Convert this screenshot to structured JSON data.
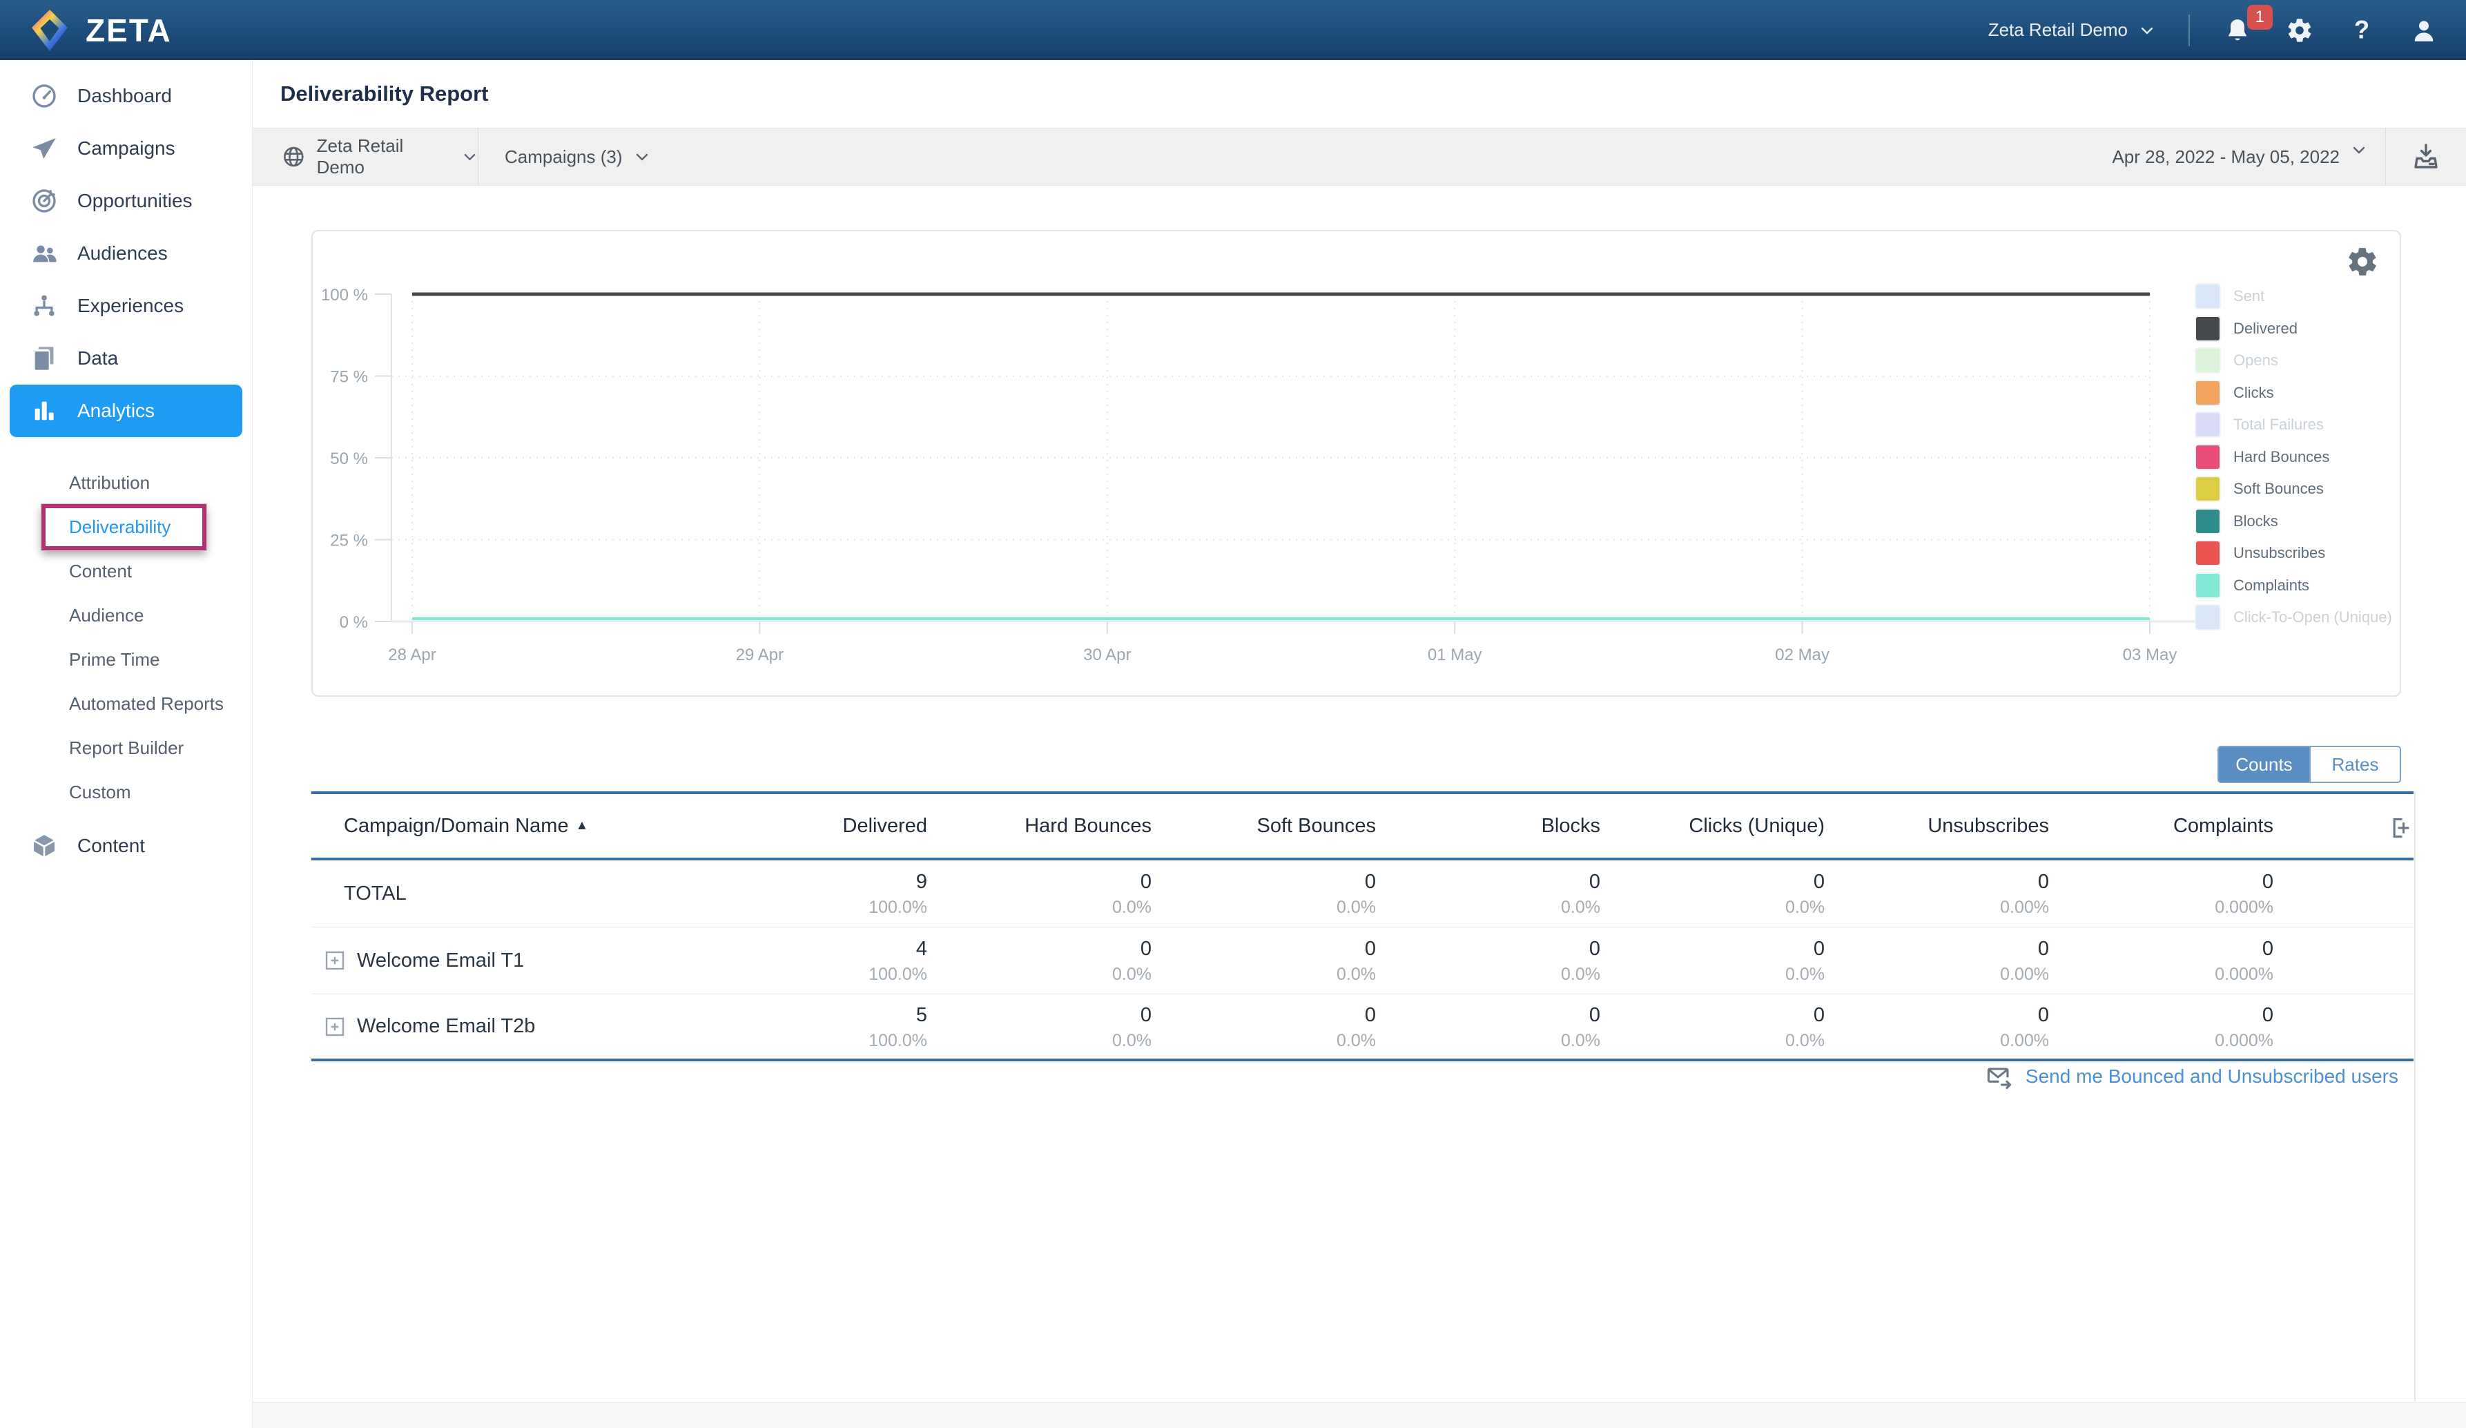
{
  "topbar": {
    "brand": "ZETA",
    "account": "Zeta Retail Demo",
    "notification_count": "1"
  },
  "sidebar": {
    "items": [
      {
        "label": "Dashboard",
        "icon": "dashboard",
        "active": false
      },
      {
        "label": "Campaigns",
        "icon": "campaigns",
        "active": false
      },
      {
        "label": "Opportunities",
        "icon": "opportunities",
        "active": false
      },
      {
        "label": "Audiences",
        "icon": "audiences",
        "active": false
      },
      {
        "label": "Experiences",
        "icon": "experiences",
        "active": false
      },
      {
        "label": "Data",
        "icon": "data",
        "active": false
      },
      {
        "label": "Analytics",
        "icon": "analytics",
        "active": true
      }
    ],
    "analytics_subitems": [
      {
        "label": "Attribution",
        "selected": false,
        "annotated": false
      },
      {
        "label": "Deliverability",
        "selected": true,
        "annotated": true
      },
      {
        "label": "Content",
        "selected": false,
        "annotated": false
      },
      {
        "label": "Audience",
        "selected": false,
        "annotated": false
      },
      {
        "label": "Prime Time",
        "selected": false,
        "annotated": false
      },
      {
        "label": "Automated Reports",
        "selected": false,
        "annotated": false
      },
      {
        "label": "Report Builder",
        "selected": false,
        "annotated": false
      },
      {
        "label": "Custom",
        "selected": false,
        "annotated": false
      }
    ],
    "bottom_items": [
      {
        "label": "Content",
        "icon": "content",
        "active": false
      }
    ]
  },
  "page": {
    "title": "Deliverability Report"
  },
  "filters": {
    "account": "Zeta Retail Demo",
    "campaigns": "Campaigns (3)",
    "date_range": "Apr 28, 2022  -  May 05, 2022"
  },
  "chart_data": {
    "type": "line",
    "x": [
      "28 Apr",
      "29 Apr",
      "30 Apr",
      "01 May",
      "02 May",
      "03 May"
    ],
    "y_ticks": [
      "100 %",
      "75 %",
      "50 %",
      "25 %",
      "0 %"
    ],
    "ylim": [
      0,
      100
    ],
    "grid": "dotted",
    "legend_position": "right",
    "series": [
      {
        "name": "Sent",
        "color": "#d9e7f8",
        "enabled": false,
        "values": null
      },
      {
        "name": "Delivered",
        "color": "#45484c",
        "enabled": true,
        "values": [
          100,
          100,
          100,
          100,
          100,
          100
        ]
      },
      {
        "name": "Opens",
        "color": "#dcf5da",
        "enabled": false,
        "values": null
      },
      {
        "name": "Clicks",
        "color": "#f2a35e",
        "enabled": true,
        "values": [
          0,
          0,
          0,
          0,
          0,
          0
        ]
      },
      {
        "name": "Total Failures",
        "color": "#dadbf6",
        "enabled": false,
        "values": null
      },
      {
        "name": "Hard Bounces",
        "color": "#ea4d78",
        "enabled": true,
        "values": [
          0,
          0,
          0,
          0,
          0,
          0
        ]
      },
      {
        "name": "Soft Bounces",
        "color": "#ddce45",
        "enabled": true,
        "values": [
          0,
          0,
          0,
          0,
          0,
          0
        ]
      },
      {
        "name": "Blocks",
        "color": "#2f8d8d",
        "enabled": true,
        "values": [
          0,
          0,
          0,
          0,
          0,
          0
        ]
      },
      {
        "name": "Unsubscribes",
        "color": "#ec5453",
        "enabled": true,
        "values": [
          0,
          0,
          0,
          0,
          0,
          0
        ]
      },
      {
        "name": "Complaints",
        "color": "#82e9d7",
        "enabled": true,
        "values": [
          0,
          0,
          0,
          0,
          0,
          0
        ]
      },
      {
        "name": "Click-To-Open (Unique)",
        "color": "#d9e7f8",
        "enabled": false,
        "values": null
      }
    ]
  },
  "toggle": {
    "counts": "Counts",
    "rates": "Rates",
    "selected": "Counts"
  },
  "table": {
    "columns": [
      "Campaign/Domain Name",
      "Delivered",
      "Hard Bounces",
      "Soft Bounces",
      "Blocks",
      "Clicks (Unique)",
      "Unsubscribes",
      "Complaints"
    ],
    "sort": {
      "column": "Campaign/Domain Name",
      "direction": "asc"
    },
    "rows": [
      {
        "name": "TOTAL",
        "expandable": false,
        "values": [
          "9",
          "0",
          "0",
          "0",
          "0",
          "0",
          "0"
        ],
        "rates": [
          "100.0%",
          "0.0%",
          "0.0%",
          "0.0%",
          "0.0%",
          "0.00%",
          "0.000%"
        ]
      },
      {
        "name": "Welcome Email T1",
        "expandable": true,
        "values": [
          "4",
          "0",
          "0",
          "0",
          "0",
          "0",
          "0"
        ],
        "rates": [
          "100.0%",
          "0.0%",
          "0.0%",
          "0.0%",
          "0.0%",
          "0.00%",
          "0.000%"
        ]
      },
      {
        "name": "Welcome Email T2b",
        "expandable": true,
        "values": [
          "5",
          "0",
          "0",
          "0",
          "0",
          "0",
          "0"
        ],
        "rates": [
          "100.0%",
          "0.0%",
          "0.0%",
          "0.0%",
          "0.0%",
          "0.00%",
          "0.000%"
        ]
      }
    ]
  },
  "footer_link": {
    "label": "Send me Bounced and Unsubscribed users"
  },
  "colors": {
    "topbar": "#1d4d7b",
    "nav_active": "#1e9bf2",
    "selected_link": "#2196f3",
    "annotation": "#b03070",
    "table_accent": "#3a6d9e",
    "toggle_active": "#5a8ec2",
    "link": "#4a90d9",
    "badge": "#d5504e"
  },
  "icons": [
    "zeta-logo",
    "chevron-down",
    "bell",
    "gear",
    "question",
    "user",
    "globe",
    "download",
    "envelope-forward",
    "plus-box",
    "add-column",
    "sort-asc"
  ]
}
